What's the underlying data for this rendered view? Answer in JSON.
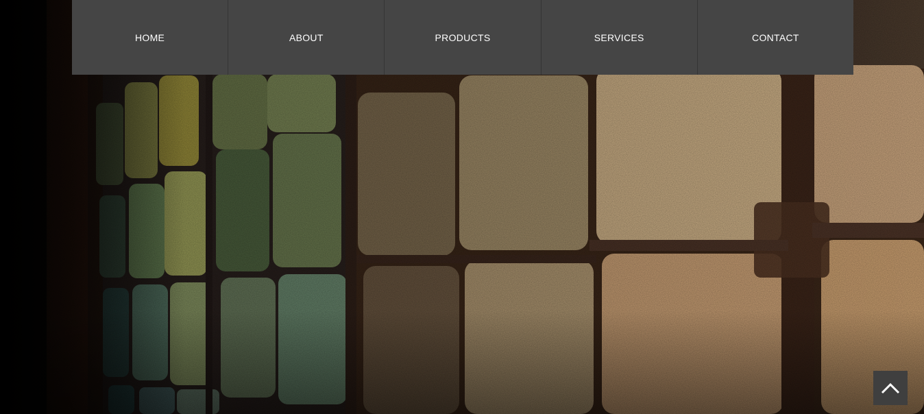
{
  "nav": {
    "items": [
      {
        "label": "HOME"
      },
      {
        "label": "ABOUT"
      },
      {
        "label": "PRODUCTS"
      },
      {
        "label": "SERVICES"
      },
      {
        "label": "CONTACT"
      }
    ]
  },
  "hero": {
    "image_subject": "carpet-sample-display-wall"
  },
  "back_to_top": {
    "icon": "chevron-up-icon"
  },
  "colors": {
    "nav_background": "#454545",
    "nav_text": "#ffffff",
    "button_background": "#3f3f3f"
  }
}
